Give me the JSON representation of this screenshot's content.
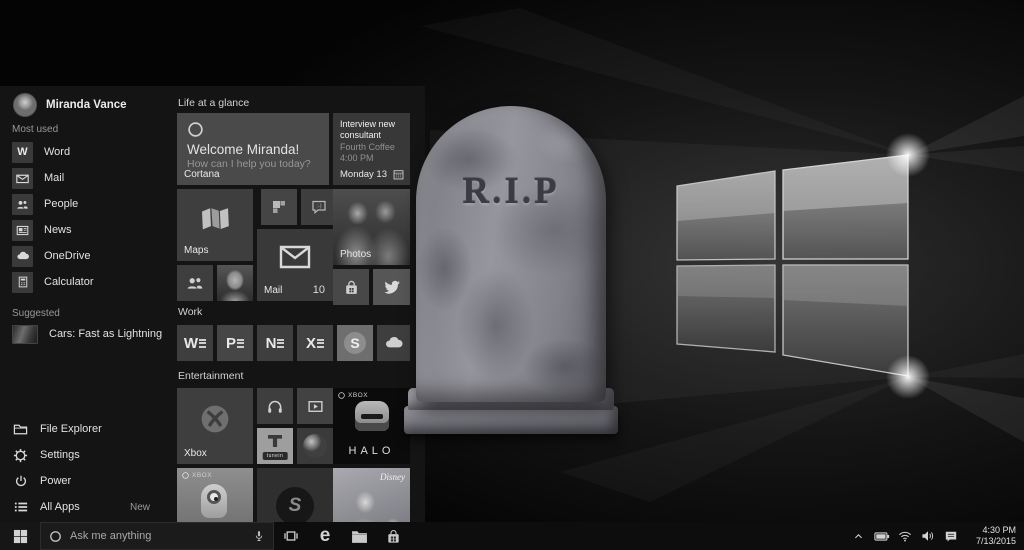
{
  "user": {
    "name": "Miranda Vance"
  },
  "start_menu": {
    "most_used_header": "Most used",
    "most_used": [
      {
        "label": "Word",
        "glyph": "W"
      },
      {
        "label": "Mail"
      },
      {
        "label": "People"
      },
      {
        "label": "News"
      },
      {
        "label": "OneDrive"
      },
      {
        "label": "Calculator"
      }
    ],
    "suggested_header": "Suggested",
    "suggested_app": {
      "label": "Cars: Fast as Lightning"
    },
    "system_items": [
      {
        "label": "File Explorer"
      },
      {
        "label": "Settings"
      },
      {
        "label": "Power"
      },
      {
        "label": "All Apps",
        "badge": "New"
      }
    ],
    "group_labels": {
      "life": "Life at a glance",
      "work": "Work",
      "entertainment": "Entertainment"
    },
    "tiles": {
      "cortana": {
        "title": "Welcome Miranda!",
        "subtitle": "How can I help you today?",
        "app": "Cortana"
      },
      "calendar": {
        "event": "Interview new consultant",
        "location": "Fourth Coffee",
        "time": "4:00 PM",
        "date": "Monday 13"
      },
      "maps": {
        "label": "Maps"
      },
      "messaging": {
        "glyph": ":-)"
      },
      "photos": {
        "label": "Photos"
      },
      "mail": {
        "label": "Mail",
        "count": "10"
      },
      "work_glyphs": {
        "word": "W",
        "powerpoint": "P",
        "onenote": "N",
        "excel": "X",
        "skype": "S"
      },
      "xbox": {
        "label": "Xbox"
      },
      "halo": {
        "badge": "XBOX",
        "title": "HALO"
      },
      "minions": {
        "badge": "XBOX"
      },
      "shazam": {
        "glyph": "S"
      },
      "tunein": {
        "label": "tunein"
      },
      "frozen": {
        "brand": "Disney"
      }
    }
  },
  "overlay": {
    "tombstone_text": "R.I.P"
  },
  "taskbar": {
    "search_placeholder": "Ask me anything",
    "edge_glyph": "e",
    "clock": {
      "time": "4:30 PM",
      "date": "7/13/2015"
    }
  }
}
